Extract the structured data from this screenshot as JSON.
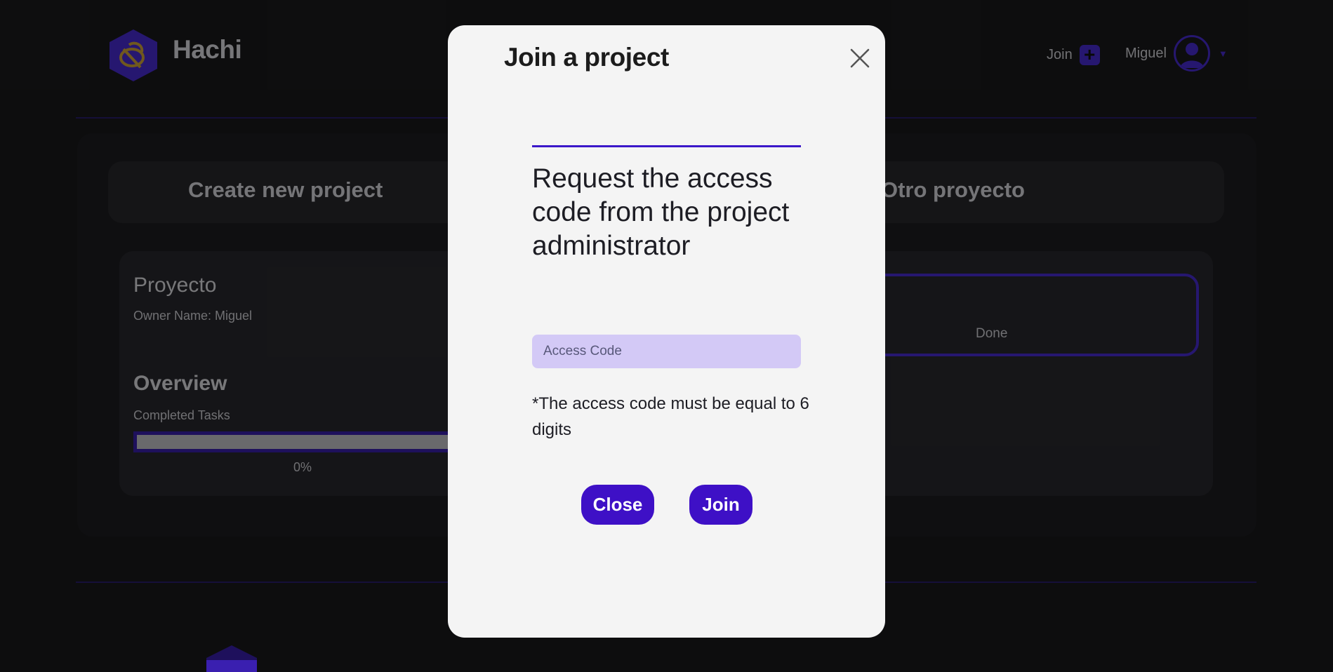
{
  "header": {
    "brand": "Hachi",
    "join_label": "Join",
    "user_name": "Miguel"
  },
  "tabs": {
    "create": "Create new project",
    "other": "Otro proyecto"
  },
  "project": {
    "name": "Proyecto",
    "owner": "Owner Name: Miguel",
    "overview": "Overview",
    "completed_label": "Completed Tasks",
    "completed_percent": "0%",
    "completed_fraction": 0.0,
    "done_label": "Done"
  },
  "modal": {
    "title": "Join a project",
    "request_text": "Request the access code from the project administrator",
    "input_placeholder": "Access Code",
    "input_value": "",
    "hint": "*The access code must be equal to 6 digits",
    "close_label": "Close",
    "join_label": "Join"
  },
  "colors": {
    "accent": "#3e10c6",
    "input_bg": "#d3c9f6",
    "modal_bg": "#f4f4f4",
    "app_bg": "#1a1a1c"
  },
  "icons": {
    "logo": "bee-hexagon-logo-icon",
    "plus": "plus-icon",
    "avatar": "user-avatar-icon",
    "caret": "caret-down-icon",
    "close": "close-icon"
  }
}
